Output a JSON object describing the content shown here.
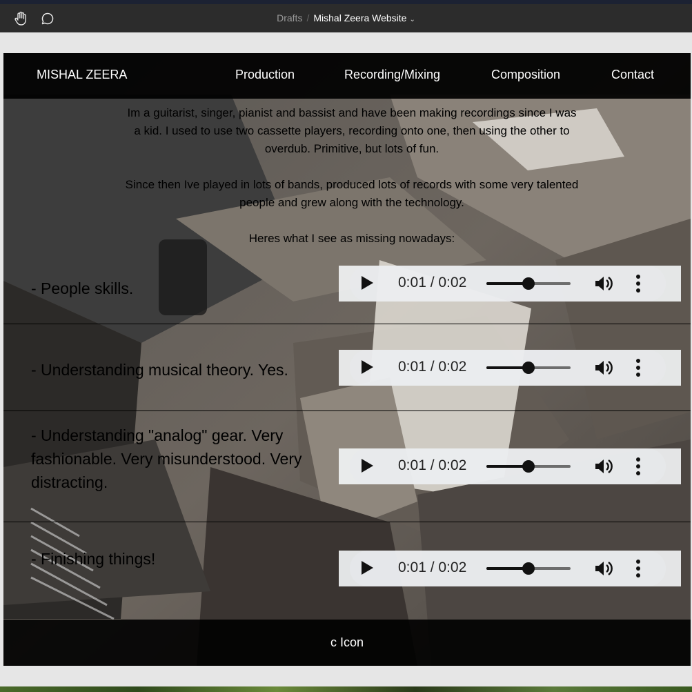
{
  "editor": {
    "breadcrumb_parent": "Drafts",
    "breadcrumb_separator": "/",
    "breadcrumb_current": "Mishal Zeera Website",
    "breadcrumb_caret": "⌄",
    "tools": [
      "hand-tool-icon",
      "comment-icon"
    ]
  },
  "site": {
    "brand": "MISHAL ZEERA",
    "nav": [
      "Production",
      "Recording/Mixing",
      "Composition",
      "Contact"
    ],
    "intro": [
      "Im a guitarist, singer, pianist and bassist and have been making recordings since I was a kid. I used to use two cassette players, recording onto one, then using the other to overdub. Primitive, but lots of fun.",
      "Since then Ive played in lots of bands, produced lots of records with some very talented people and grew along with the technology.",
      "Heres what I see as missing nowadays:"
    ],
    "items": [
      {
        "label": "- People skills.",
        "time": "0:01 / 0:02",
        "progress": 0.5
      },
      {
        "label": "- Understanding musical theory. Yes.",
        "time": "0:01 / 0:02",
        "progress": 0.5
      },
      {
        "label": "- Understanding \"analog\" gear. Very fashionable. Very misunderstood. Very distracting.",
        "time": "0:01 / 0:02",
        "progress": 0.5
      },
      {
        "label": "- Finishing things!",
        "time": "0:01 / 0:02",
        "progress": 0.5
      }
    ],
    "footer": "c Icon"
  },
  "colors": {
    "toolbar": "#2c2c2c",
    "nav_background": "#000000",
    "footer_background": "#000000",
    "player_background": "#f1f3f4"
  }
}
